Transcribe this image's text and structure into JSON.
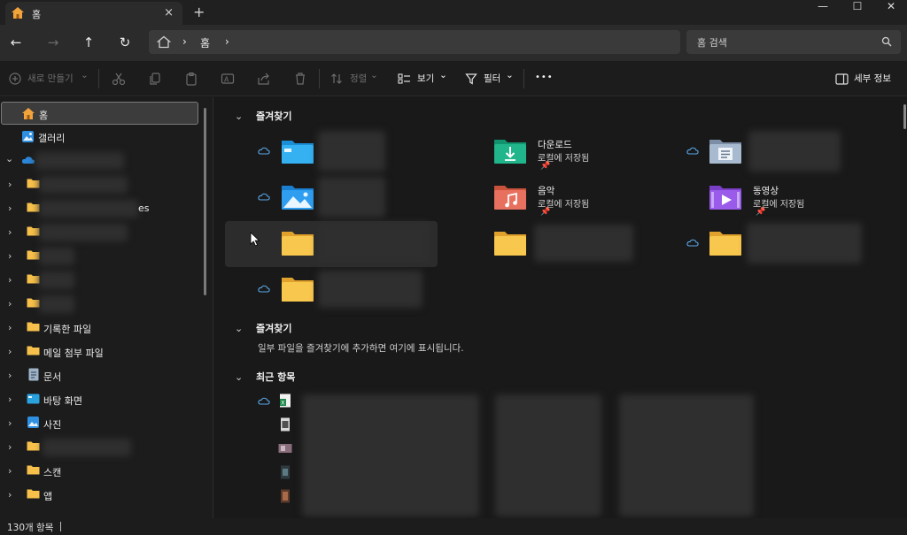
{
  "tab": {
    "title": "홈",
    "close_icon": "×",
    "new_tab_icon": "+"
  },
  "window_controls": {
    "minimize": "—",
    "maximize": "☐",
    "close": "✕"
  },
  "nav": {
    "back": "←",
    "forward": "→",
    "up": "↑",
    "refresh": "↻"
  },
  "address": {
    "segment": "홈",
    "separator": "›"
  },
  "search": {
    "placeholder": "홈 검색"
  },
  "toolbar": {
    "new_label": "새로 만들기",
    "sort_label": "정렬",
    "view_label": "보기",
    "filter_label": "필터",
    "more_label": "•••",
    "details_label": "세부 정보",
    "dropdown_caret": "⌄"
  },
  "sidebar": {
    "items": [
      {
        "label": "홈",
        "icon": "home-icon"
      },
      {
        "label": "갤러리",
        "icon": "gallery-icon"
      },
      {
        "label": "",
        "icon": "onedrive-icon"
      },
      {
        "label": "",
        "icon": "folder-icon"
      },
      {
        "label": "es",
        "icon": "folder-icon"
      },
      {
        "label": "",
        "icon": "folder-icon"
      },
      {
        "label": "",
        "icon": "folder-icon"
      },
      {
        "label": "",
        "icon": "folder-icon"
      },
      {
        "label": "",
        "icon": "folder-icon"
      },
      {
        "label": "기록한 파일",
        "icon": "folder-icon"
      },
      {
        "label": "메일 첨부 파일",
        "icon": "folder-icon"
      },
      {
        "label": "문서",
        "icon": "documents-icon"
      },
      {
        "label": "바탕 화면",
        "icon": "desktop-icon"
      },
      {
        "label": "사진",
        "icon": "pictures-icon"
      },
      {
        "label": "",
        "icon": "folder-icon"
      },
      {
        "label": "스캔",
        "icon": "folder-icon"
      },
      {
        "label": "앱",
        "icon": "folder-icon"
      }
    ]
  },
  "sections": {
    "quick_access": "즐겨찾기",
    "favorites": "즐겨찾기",
    "favorites_empty": "일부 파일을 즐겨찾기에 추가하면 여기에 표시됩니다.",
    "recent": "최근 항목"
  },
  "quick_access": {
    "pinned_tiles": [
      {
        "name": "다운로드",
        "sub": "로컬에 저장됨",
        "icon": "downloads-folder-icon"
      },
      {
        "name": "음악",
        "sub": "로컬에 저장됨",
        "icon": "music-folder-icon"
      },
      {
        "name": "동영상",
        "sub": "로컬에 저장됨",
        "icon": "videos-folder-icon"
      }
    ]
  },
  "status": {
    "item_count": "130개 항목"
  }
}
